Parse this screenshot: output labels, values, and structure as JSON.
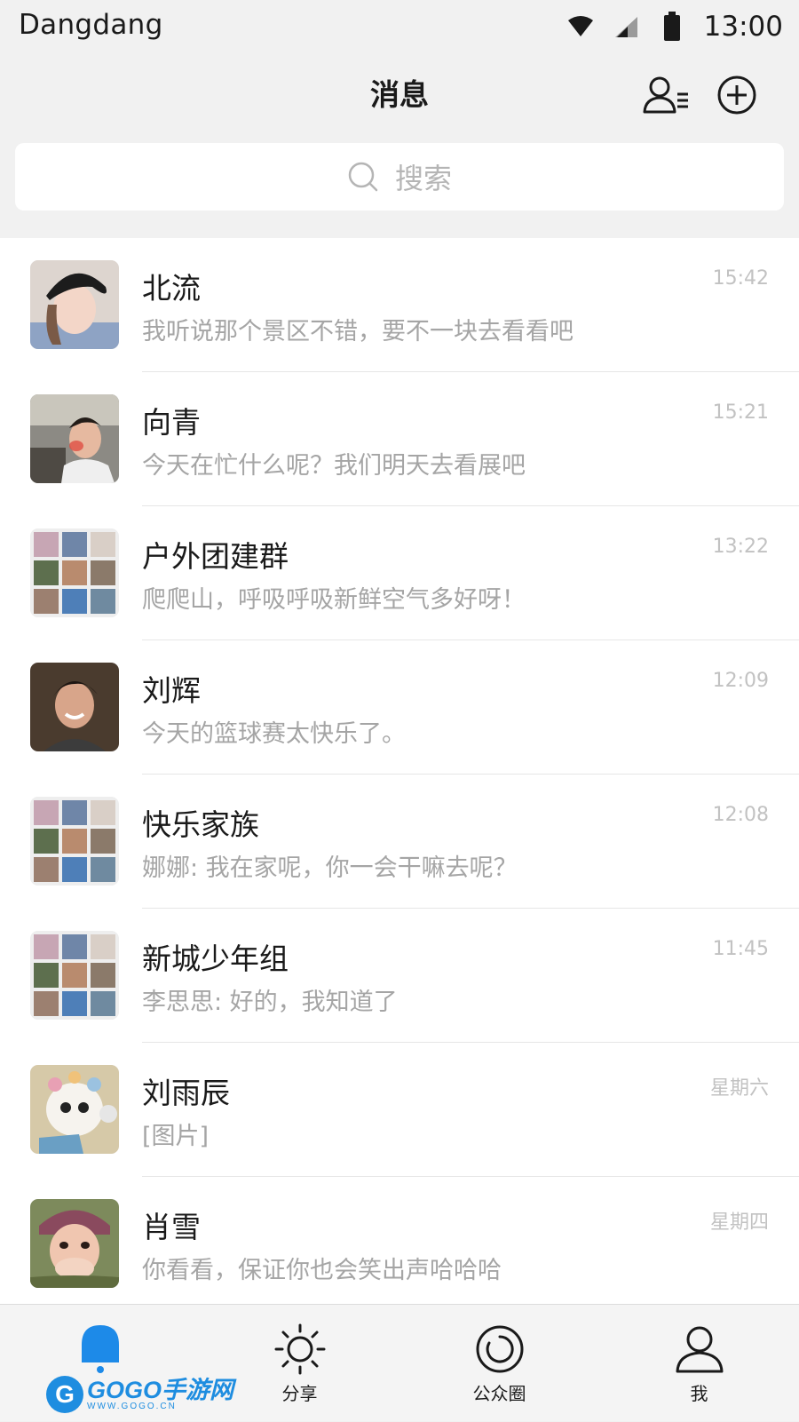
{
  "status_bar": {
    "carrier": "Dangdang",
    "time": "13:00",
    "icons": [
      "wifi-icon",
      "signal-icon",
      "battery-icon"
    ]
  },
  "header": {
    "title": "消息",
    "actions": [
      "contacts-icon",
      "add-circle-icon"
    ]
  },
  "search": {
    "placeholder": "搜索"
  },
  "conversations": [
    {
      "name": "北流",
      "preview": "我听说那个景区不错，要不一块去看看吧",
      "time": "15:42",
      "avatar": "avatar-photo-woman-beret"
    },
    {
      "name": "向青",
      "preview": "今天在忙什么呢？我们明天去看展吧",
      "time": "15:21",
      "avatar": "avatar-photo-man-car"
    },
    {
      "name": "户外团建群",
      "preview": "爬爬山，呼吸呼吸新鲜空气多好呀！",
      "time": "13:22",
      "avatar": "avatar-group-grid"
    },
    {
      "name": "刘辉",
      "preview": "今天的篮球赛太快乐了。",
      "time": "12:09",
      "avatar": "avatar-photo-man-smiling"
    },
    {
      "name": "快乐家族",
      "preview": "娜娜: 我在家呢，你一会干嘛去呢？",
      "time": "12:08",
      "avatar": "avatar-group-grid"
    },
    {
      "name": "新城少年组",
      "preview": "李思思: 好的，我知道了",
      "time": "11:45",
      "avatar": "avatar-group-grid"
    },
    {
      "name": "刘雨辰",
      "preview": "[图片]",
      "time": "星期六",
      "avatar": "avatar-plush-toy"
    },
    {
      "name": "肖雪",
      "preview": "你看看，保证你也会笑出声哈哈哈",
      "time": "星期四",
      "avatar": "avatar-photo-woman-hat"
    }
  ],
  "tabbar": {
    "tabs": [
      {
        "label": "",
        "icon": "chat-bubble-icon",
        "active": true
      },
      {
        "label": "分享",
        "icon": "sun-icon"
      },
      {
        "label": "公众圈",
        "icon": "circle-ring-icon"
      },
      {
        "label": "我",
        "icon": "person-icon"
      }
    ]
  },
  "watermark": {
    "logo_letter": "G",
    "main": "GOGO手游网",
    "sub": "WWW.GOGO.CN"
  },
  "colors": {
    "background": "#f1f1f1",
    "accent": "#1e8de0",
    "active_tab": "#1d8ae8",
    "secondary_text": "#a5a5a5"
  }
}
